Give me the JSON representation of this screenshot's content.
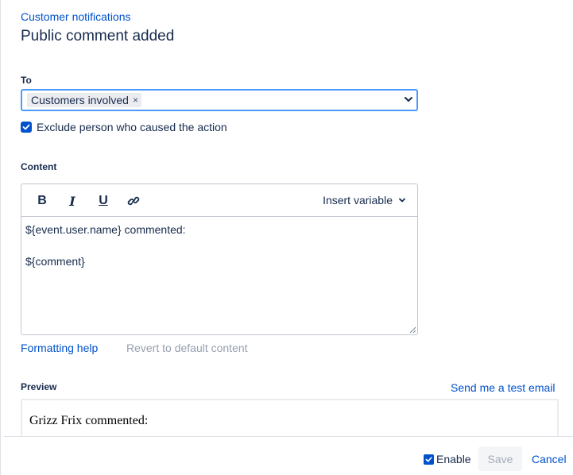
{
  "header": {
    "breadcrumb": "Customer notifications",
    "title": "Public comment added"
  },
  "to": {
    "label": "To",
    "selected": "Customers involved",
    "chip_remove": "×"
  },
  "exclude": {
    "label": "Exclude person who caused the action",
    "checked": true
  },
  "content": {
    "label": "Content",
    "toolbar": {
      "bold": "B",
      "italic": "I",
      "underline": "U",
      "insert_variable": "Insert variable"
    },
    "body": "${event.user.name} commented:\n\n${comment}",
    "formatting_help": "Formatting help",
    "revert": "Revert to default content"
  },
  "preview": {
    "label": "Preview",
    "send_test": "Send me a test email",
    "text": "Grizz Frix commented:"
  },
  "footer": {
    "enable_label": "Enable",
    "enable_checked": true,
    "save_label": "Save",
    "cancel_label": "Cancel"
  },
  "colors": {
    "link": "#0052cc",
    "focus_border": "#4c9aff",
    "disabled_text": "#97a0af"
  },
  "icons": {
    "link": "link-icon",
    "chevron": "chevron-down-icon",
    "check": "check-icon"
  }
}
